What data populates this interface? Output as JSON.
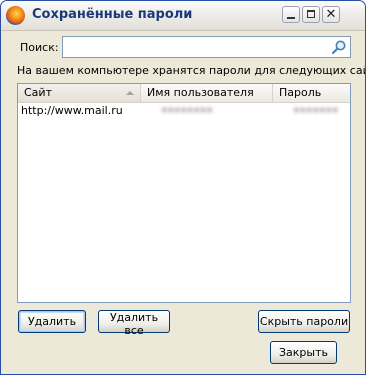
{
  "window": {
    "title": "Сохранённые пароли"
  },
  "search": {
    "label": "Поиск:",
    "value": "",
    "placeholder": ""
  },
  "description": "На вашем компьютере хранятся пароли для следующих сайтов:",
  "table": {
    "columns": [
      "Сайт",
      "Имя пользователя",
      "Пароль"
    ],
    "rows": [
      {
        "site": "http://www.mail.ru",
        "username": "••••••••",
        "password": "•••••••"
      }
    ]
  },
  "buttons": {
    "remove": "Удалить",
    "remove_all": "Удалить все",
    "hide_passwords": "Скрыть пароли",
    "close": "Закрыть"
  },
  "colors": {
    "title_text": "#1c3a7a",
    "button_border": "#003c74",
    "field_border": "#7f9db9"
  }
}
